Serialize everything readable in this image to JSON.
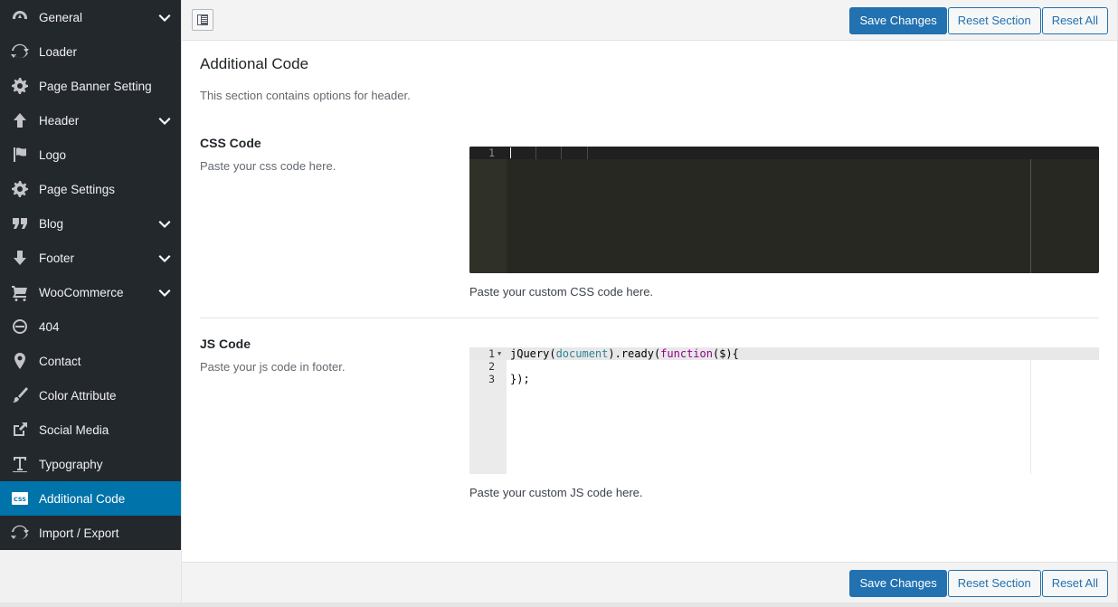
{
  "sidebar": {
    "items": [
      {
        "label": "General",
        "icon": "dashboard-icon",
        "has_submenu": true,
        "active": false
      },
      {
        "label": "Loader",
        "icon": "refresh-icon",
        "has_submenu": false,
        "active": false
      },
      {
        "label": "Page Banner Setting",
        "icon": "gear-icon",
        "has_submenu": false,
        "active": false
      },
      {
        "label": "Header",
        "icon": "arrow-up-icon",
        "has_submenu": true,
        "active": false
      },
      {
        "label": "Logo",
        "icon": "flag-icon",
        "has_submenu": false,
        "active": false
      },
      {
        "label": "Page Settings",
        "icon": "gear-icon",
        "has_submenu": false,
        "active": false
      },
      {
        "label": "Blog",
        "icon": "quote-icon",
        "has_submenu": true,
        "active": false
      },
      {
        "label": "Footer",
        "icon": "arrow-down-icon",
        "has_submenu": true,
        "active": false
      },
      {
        "label": "WooCommerce",
        "icon": "cart-icon",
        "has_submenu": true,
        "active": false
      },
      {
        "label": "404",
        "icon": "no-entry-icon",
        "has_submenu": false,
        "active": false
      },
      {
        "label": "Contact",
        "icon": "location-pin-icon",
        "has_submenu": false,
        "active": false
      },
      {
        "label": "Color Attribute",
        "icon": "brush-icon",
        "has_submenu": false,
        "active": false
      },
      {
        "label": "Social Media",
        "icon": "share-icon",
        "has_submenu": false,
        "active": false
      },
      {
        "label": "Typography",
        "icon": "text-icon",
        "has_submenu": false,
        "active": false
      },
      {
        "label": "Additional Code",
        "icon": "css-icon",
        "has_submenu": false,
        "active": true
      },
      {
        "label": "Import / Export",
        "icon": "refresh-icon",
        "has_submenu": false,
        "active": false
      }
    ]
  },
  "toolbar": {
    "save_label": "Save Changes",
    "reset_section_label": "Reset Section",
    "reset_all_label": "Reset All"
  },
  "section": {
    "title": "Additional Code",
    "description": "This section contains options for header."
  },
  "fields": {
    "css": {
      "title": "CSS Code",
      "subtitle": "Paste your css code here.",
      "help": "Paste your custom CSS code here.",
      "line_numbers": [
        "1"
      ]
    },
    "js": {
      "title": "JS Code",
      "subtitle": "Paste your js code in footer.",
      "help": "Paste your custom JS code here.",
      "line_numbers": [
        "1",
        "2",
        "3"
      ],
      "lines": [
        {
          "tokens": [
            {
              "text": "jQuery(",
              "kind": "plain"
            },
            {
              "text": "document",
              "kind": "var"
            },
            {
              "text": ").ready(",
              "kind": "plain"
            },
            {
              "text": "function",
              "kind": "kw"
            },
            {
              "text": "($){",
              "kind": "plain"
            }
          ]
        },
        {
          "tokens": []
        },
        {
          "tokens": [
            {
              "text": "});",
              "kind": "plain"
            }
          ]
        }
      ]
    }
  },
  "colors": {
    "sidebar_bg": "#23282d",
    "active_bg": "#0073aa",
    "primary_button": "#2271b1",
    "css_editor_bg": "#272822"
  }
}
